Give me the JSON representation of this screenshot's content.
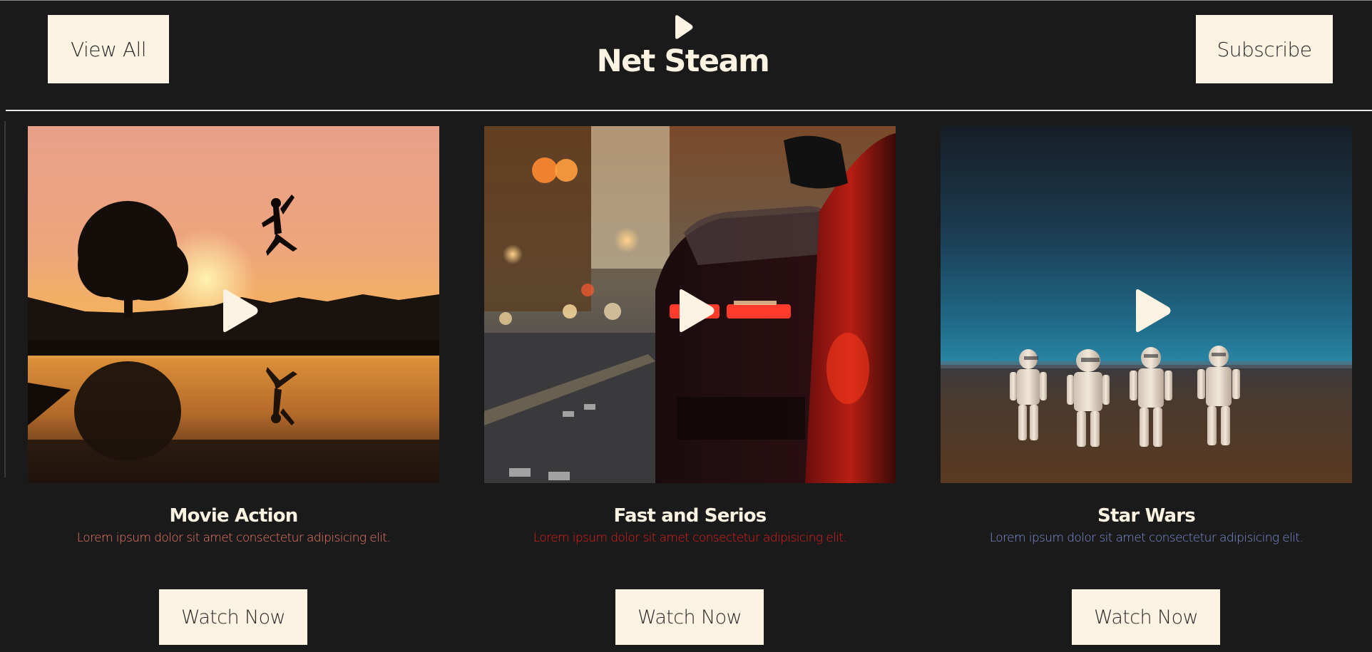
{
  "header": {
    "view_all_label": "View All",
    "brand_title": "Net Steam",
    "brand_icon": "play-icon",
    "subscribe_label": "Subscribe"
  },
  "cards": [
    {
      "title": "Movie Action",
      "description": "Lorem ipsum dolor sit amet consectetur adipisicing elit.",
      "description_color": "#f07a6a",
      "button_label": "Watch Now",
      "image": "sunset-silhouette-jump"
    },
    {
      "title": "Fast and Serios",
      "description": "Lorem ipsum dolor sit amet consectetur adipisicing elit.",
      "description_color": "#e81e1e",
      "button_label": "Watch Now",
      "image": "red-car-street-night"
    },
    {
      "title": "Star Wars",
      "description": "Lorem ipsum dolor sit amet consectetur adipisicing elit.",
      "description_color": "#7d92d8",
      "button_label": "Watch Now",
      "image": "stormtroopers-figurines"
    }
  ],
  "colors": {
    "background": "#1a1a1a",
    "button_bg": "#fdf3e3",
    "title_text": "#fdf3e3"
  }
}
